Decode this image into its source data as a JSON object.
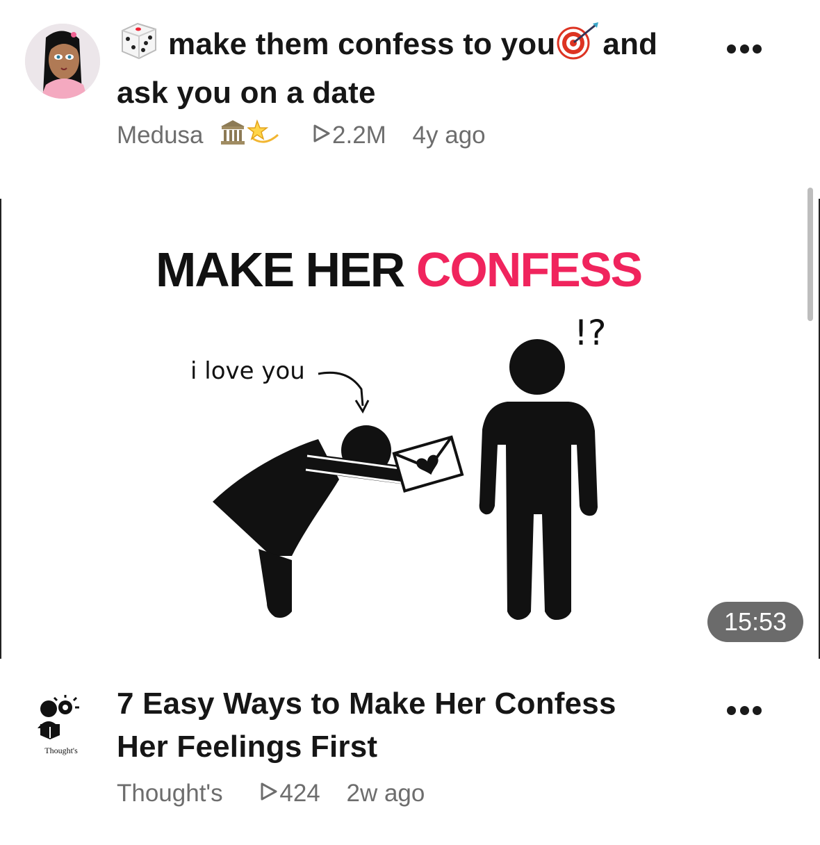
{
  "posts": [
    {
      "title_line1": "make them confess to you",
      "title_line1_end": "and",
      "title_line2": "ask you on a date",
      "channel": "Medusa",
      "views": "2.2M",
      "age": "4y ago",
      "icons": [
        "dice-icon",
        "target-icon",
        "building-icon",
        "dizzy-star-icon"
      ]
    },
    {
      "title_line1": "7 Easy Ways to Make Her Confess",
      "title_line2": "Her Feelings First",
      "channel": "Thought's",
      "views": "424",
      "age": "2w ago",
      "logo_text": "Thought's"
    }
  ],
  "video": {
    "thumbnail_title_black": "MAKE HER",
    "thumbnail_title_pink": "CONFESS",
    "bubble_text": "i love you",
    "exclaim": "!?",
    "duration": "15:53",
    "accent_color": "#f0245d"
  }
}
